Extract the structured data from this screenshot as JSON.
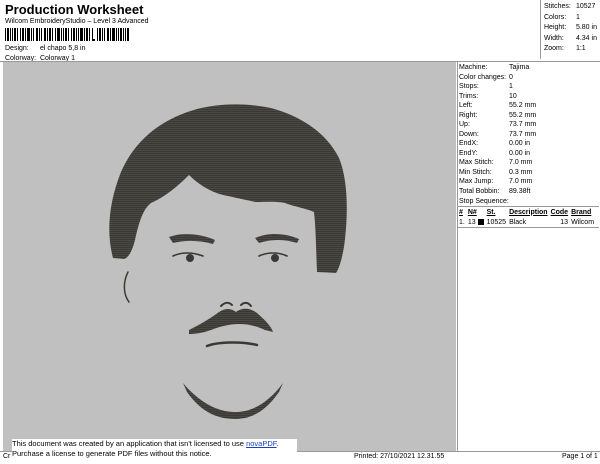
{
  "header": {
    "title": "Production Worksheet",
    "subtitle": "Wilcom EmbroideryStudio – Level 3 Advanced",
    "design_label": "Design:",
    "design_value": "el chapo 5,8 in",
    "colorway_label": "Colorway:",
    "colorway_value": "Colorway 1"
  },
  "stats": [
    {
      "label": "Stitches:",
      "value": "10527"
    },
    {
      "label": "Colors:",
      "value": "1"
    },
    {
      "label": "Height:",
      "value": "5.80 in"
    },
    {
      "label": "Width:",
      "value": "4.34 in"
    },
    {
      "label": "Zoom:",
      "value": "1:1"
    }
  ],
  "machine_info": [
    {
      "label": "Machine:",
      "value": "Tajima"
    },
    {
      "label": "Color changes:",
      "value": "0"
    },
    {
      "label": "Stops:",
      "value": "1"
    },
    {
      "label": "Trims:",
      "value": "10"
    },
    {
      "label": "Left:",
      "value": "55.2 mm"
    },
    {
      "label": "Right:",
      "value": "55.2 mm"
    },
    {
      "label": "Up:",
      "value": "73.7 mm"
    },
    {
      "label": "Down:",
      "value": "73.7 mm"
    },
    {
      "label": "EndX:",
      "value": "0.00 in"
    },
    {
      "label": "EndY:",
      "value": "0.00 in"
    },
    {
      "label": "Max Stitch:",
      "value": "7.0 mm"
    },
    {
      "label": "Min Stitch:",
      "value": "0.3 mm"
    },
    {
      "label": "Max Jump:",
      "value": "7.0 mm"
    },
    {
      "label": "Total Bobbin:",
      "value": "89.38ft"
    }
  ],
  "stop_sequence": {
    "title": "Stop Sequence:",
    "columns": [
      "#",
      "N#",
      "St.",
      "Description",
      "Code",
      "Brand"
    ],
    "rows": [
      {
        "num": "1.",
        "n": "13",
        "swatch_color": "#000000",
        "st": "10525",
        "description": "Black",
        "code": "13",
        "brand": "Wilcom"
      }
    ]
  },
  "notice": {
    "line1_prefix": "This document was created by an application that isn't licensed to use ",
    "link_text": "novaPDF",
    "line1_suffix": ".",
    "line2": "Purchase a license to generate PDF files without this notice."
  },
  "footer": {
    "left": "Cr",
    "printed": "Printed: 27/10/2021 12.31.55",
    "page": "Page 1 of 1"
  },
  "colors": {
    "canvas_bg": "#c0c0c0",
    "thread": "#3a3935",
    "link": "#1a3fbf"
  }
}
